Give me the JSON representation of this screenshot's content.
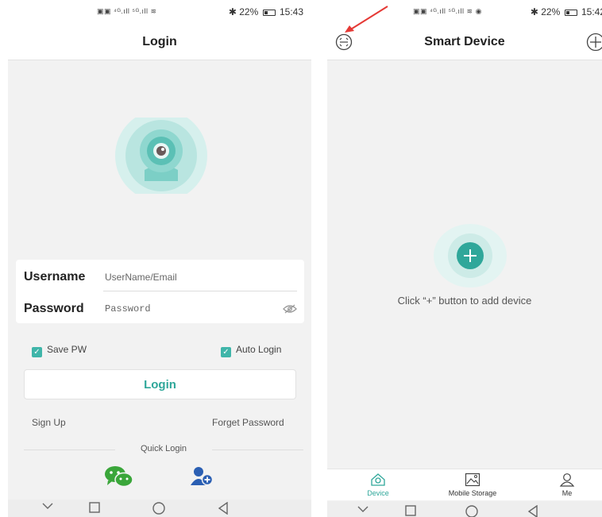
{
  "login_screen": {
    "status": {
      "time": "15:43",
      "battery": "22%"
    },
    "title": "Login",
    "username_label": "Username",
    "username_placeholder": "UserName/Email",
    "password_label": "Password",
    "password_placeholder": "Password",
    "save_pw": "Save PW",
    "auto_login": "Auto Login",
    "login_button": "Login",
    "sign_up": "Sign Up",
    "forget_password": "Forget Password",
    "quick_login": "Quick Login"
  },
  "device_screen": {
    "status": {
      "time": "15:42",
      "battery": "22%"
    },
    "title": "Smart Device",
    "hint": "Click “+” button to add device",
    "tabs": [
      {
        "label": "Device",
        "icon": "device-icon",
        "active": true
      },
      {
        "label": "Mobile Storage",
        "icon": "image-icon",
        "active": false
      },
      {
        "label": "Me",
        "icon": "person-icon",
        "active": false
      }
    ]
  },
  "colors": {
    "accent": "#2fa79a",
    "accent_light": "#bfe8e4",
    "checkbox": "#3fb5a9",
    "annotation_arrow": "#e53935"
  }
}
